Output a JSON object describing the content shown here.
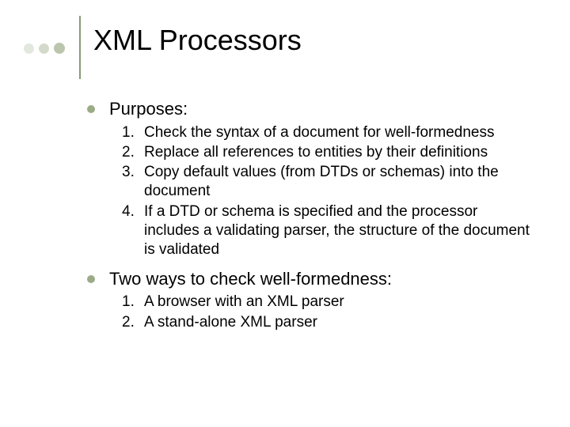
{
  "title": "XML Processors",
  "bullets": [
    {
      "label": "Purposes:",
      "items": [
        "Check the syntax of a document for well-formedness",
        "Replace all references to entities by their definitions",
        "Copy default values (from DTDs or schemas) into the document",
        "If a DTD or schema is specified and the processor includes a validating parser, the structure of the document is validated"
      ]
    },
    {
      "label": "Two ways to check well-formedness:",
      "items": [
        "A browser with an XML parser",
        "A stand-alone XML parser"
      ]
    }
  ]
}
